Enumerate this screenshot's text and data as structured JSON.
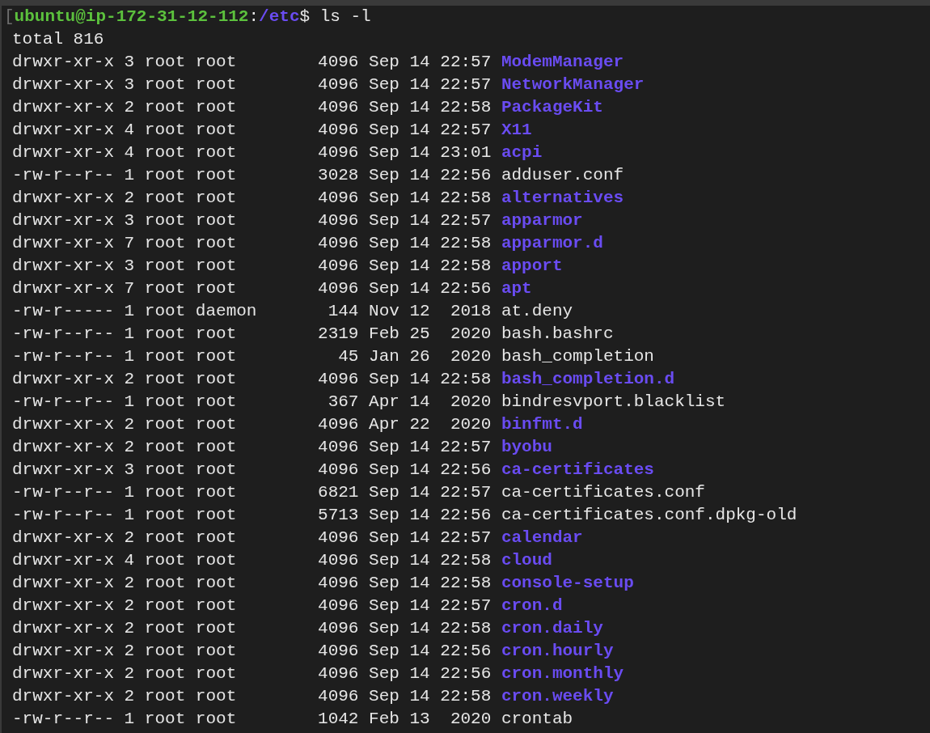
{
  "prompt": {
    "mark": "[",
    "user_host": "ubuntu@ip-172-31-12-112",
    "separator": ":",
    "path": "/etc",
    "command": "$ ls -l"
  },
  "total": "total 816",
  "entries": [
    {
      "kind": "dir",
      "details": "drwxr-xr-x 3 root root        4096 Sep 14 22:57",
      "name": "ModemManager"
    },
    {
      "kind": "dir",
      "details": "drwxr-xr-x 3 root root        4096 Sep 14 22:57",
      "name": "NetworkManager"
    },
    {
      "kind": "dir",
      "details": "drwxr-xr-x 2 root root        4096 Sep 14 22:58",
      "name": "PackageKit"
    },
    {
      "kind": "dir",
      "details": "drwxr-xr-x 4 root root        4096 Sep 14 22:57",
      "name": "X11"
    },
    {
      "kind": "dir",
      "details": "drwxr-xr-x 4 root root        4096 Sep 14 23:01",
      "name": "acpi"
    },
    {
      "kind": "file",
      "details": "-rw-r--r-- 1 root root        3028 Sep 14 22:56",
      "name": "adduser.conf"
    },
    {
      "kind": "dir",
      "details": "drwxr-xr-x 2 root root        4096 Sep 14 22:58",
      "name": "alternatives"
    },
    {
      "kind": "dir",
      "details": "drwxr-xr-x 3 root root        4096 Sep 14 22:57",
      "name": "apparmor"
    },
    {
      "kind": "dir",
      "details": "drwxr-xr-x 7 root root        4096 Sep 14 22:58",
      "name": "apparmor.d"
    },
    {
      "kind": "dir",
      "details": "drwxr-xr-x 3 root root        4096 Sep 14 22:58",
      "name": "apport"
    },
    {
      "kind": "dir",
      "details": "drwxr-xr-x 7 root root        4096 Sep 14 22:56",
      "name": "apt"
    },
    {
      "kind": "file",
      "details": "-rw-r----- 1 root daemon       144 Nov 12  2018",
      "name": "at.deny"
    },
    {
      "kind": "file",
      "details": "-rw-r--r-- 1 root root        2319 Feb 25  2020",
      "name": "bash.bashrc"
    },
    {
      "kind": "file",
      "details": "-rw-r--r-- 1 root root          45 Jan 26  2020",
      "name": "bash_completion"
    },
    {
      "kind": "dir",
      "details": "drwxr-xr-x 2 root root        4096 Sep 14 22:58",
      "name": "bash_completion.d"
    },
    {
      "kind": "file",
      "details": "-rw-r--r-- 1 root root         367 Apr 14  2020",
      "name": "bindresvport.blacklist"
    },
    {
      "kind": "dir",
      "details": "drwxr-xr-x 2 root root        4096 Apr 22  2020",
      "name": "binfmt.d"
    },
    {
      "kind": "dir",
      "details": "drwxr-xr-x 2 root root        4096 Sep 14 22:57",
      "name": "byobu"
    },
    {
      "kind": "dir",
      "details": "drwxr-xr-x 3 root root        4096 Sep 14 22:56",
      "name": "ca-certificates"
    },
    {
      "kind": "file",
      "details": "-rw-r--r-- 1 root root        6821 Sep 14 22:57",
      "name": "ca-certificates.conf"
    },
    {
      "kind": "file",
      "details": "-rw-r--r-- 1 root root        5713 Sep 14 22:56",
      "name": "ca-certificates.conf.dpkg-old"
    },
    {
      "kind": "dir",
      "details": "drwxr-xr-x 2 root root        4096 Sep 14 22:57",
      "name": "calendar"
    },
    {
      "kind": "dir",
      "details": "drwxr-xr-x 4 root root        4096 Sep 14 22:58",
      "name": "cloud"
    },
    {
      "kind": "dir",
      "details": "drwxr-xr-x 2 root root        4096 Sep 14 22:58",
      "name": "console-setup"
    },
    {
      "kind": "dir",
      "details": "drwxr-xr-x 2 root root        4096 Sep 14 22:57",
      "name": "cron.d"
    },
    {
      "kind": "dir",
      "details": "drwxr-xr-x 2 root root        4096 Sep 14 22:58",
      "name": "cron.daily"
    },
    {
      "kind": "dir",
      "details": "drwxr-xr-x 2 root root        4096 Sep 14 22:56",
      "name": "cron.hourly"
    },
    {
      "kind": "dir",
      "details": "drwxr-xr-x 2 root root        4096 Sep 14 22:56",
      "name": "cron.monthly"
    },
    {
      "kind": "dir",
      "details": "drwxr-xr-x 2 root root        4096 Sep 14 22:58",
      "name": "cron.weekly"
    },
    {
      "kind": "file",
      "details": "-rw-r--r-- 1 root root        1042 Feb 13  2020",
      "name": "crontab"
    }
  ]
}
